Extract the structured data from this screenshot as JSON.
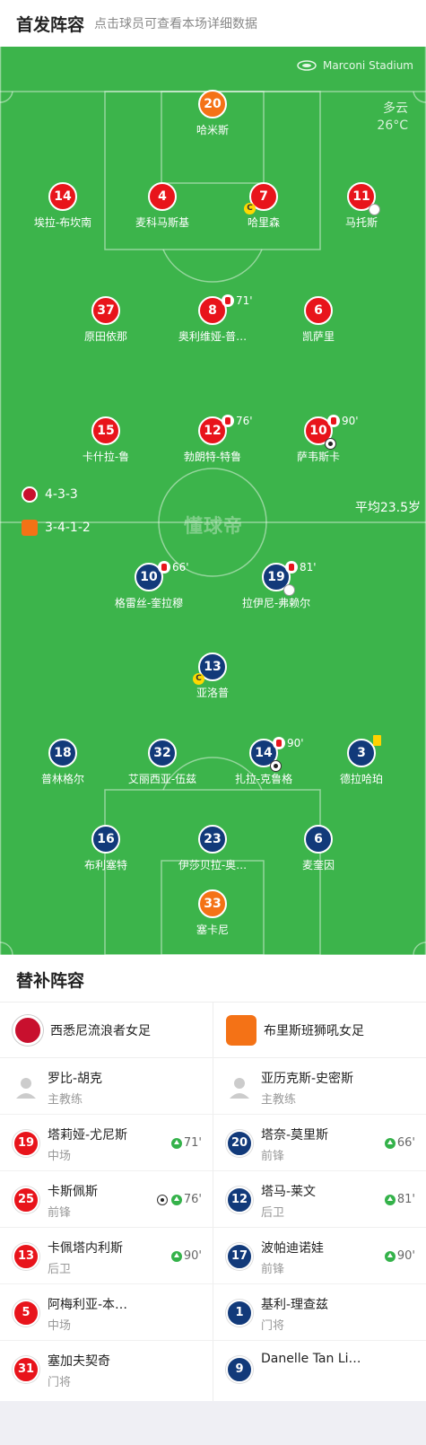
{
  "header": {
    "title": "首发阵容",
    "subtitle": "点击球员可查看本场详细数据"
  },
  "pitch": {
    "stadium": "Marconi Stadium",
    "weather": "多云",
    "temperature": "26°C",
    "watermark": "懂球帝",
    "home_formation": "4-3-3",
    "away_formation": "3-4-1-2",
    "avg_age": "平均23.5岁",
    "colors": {
      "pitch": "#3cb44b",
      "home": "#e8141b",
      "away": "#123a7a",
      "gk": "#f47216"
    },
    "home_players": [
      {
        "num": "20",
        "name": "哈米斯",
        "type": "gk"
      },
      {
        "num": "14",
        "name": "埃拉-布坎南"
      },
      {
        "num": "4",
        "name": "麦科马斯基"
      },
      {
        "num": "7",
        "name": "哈里森",
        "captain": "C"
      },
      {
        "num": "11",
        "name": "马托斯",
        "injury": true
      },
      {
        "num": "37",
        "name": "原田依那"
      },
      {
        "num": "8",
        "name": "奥利维娅-普…",
        "sub_time": "71'"
      },
      {
        "num": "6",
        "name": "凯萨里"
      },
      {
        "num": "15",
        "name": "卡什拉-鲁"
      },
      {
        "num": "12",
        "name": "勃朗特-特鲁",
        "sub_time": "76'"
      },
      {
        "num": "10",
        "name": "萨韦斯卡",
        "sub_time": "90'",
        "goal": true
      }
    ],
    "away_players": [
      {
        "num": "10",
        "name": "格雷丝-奎拉穆",
        "sub_time": "66'"
      },
      {
        "num": "19",
        "name": "拉伊尼-弗赖尔",
        "sub_time": "81'",
        "injury": true
      },
      {
        "num": "13",
        "name": "亚洛普",
        "captain": "C"
      },
      {
        "num": "18",
        "name": "普林格尔"
      },
      {
        "num": "32",
        "name": "艾丽西亚-伍兹"
      },
      {
        "num": "14",
        "name": "扎拉-克鲁格",
        "sub_time": "90'",
        "goal": true
      },
      {
        "num": "3",
        "name": "德拉哈珀",
        "yellow": true
      },
      {
        "num": "16",
        "name": "布利塞特"
      },
      {
        "num": "23",
        "name": "伊莎贝拉-奥…"
      },
      {
        "num": "6",
        "name": "麦奎因"
      },
      {
        "num": "33",
        "name": "塞卡尼",
        "type": "gk"
      }
    ]
  },
  "subs": {
    "title": "替补阵容",
    "home": {
      "team": "西悉尼流浪者女足",
      "coach": {
        "name": "罗比-胡克",
        "role": "主教练"
      },
      "players": [
        {
          "num": "19",
          "name": "塔莉娅-尤尼斯",
          "pos": "中场",
          "in": "71'"
        },
        {
          "num": "25",
          "name": "卡斯佩斯",
          "pos": "前锋",
          "in": "76'",
          "goal": true
        },
        {
          "num": "13",
          "name": "卡佩塔内利斯",
          "pos": "后卫",
          "in": "90'"
        },
        {
          "num": "5",
          "name": "阿梅利亚-本…",
          "pos": "中场"
        },
        {
          "num": "31",
          "name": "塞加夫契奇",
          "pos": "门将"
        }
      ]
    },
    "away": {
      "team": "布里斯班狮吼女足",
      "coach": {
        "name": "亚历克斯-史密斯",
        "role": "主教练"
      },
      "players": [
        {
          "num": "20",
          "name": "塔奈-莫里斯",
          "pos": "前锋",
          "in": "66'"
        },
        {
          "num": "12",
          "name": "塔马-莱文",
          "pos": "后卫",
          "in": "81'"
        },
        {
          "num": "17",
          "name": "波帕迪诺娃",
          "pos": "前锋",
          "in": "90'"
        },
        {
          "num": "1",
          "name": "基利-理查兹",
          "pos": "门将"
        },
        {
          "num": "9",
          "name": "Danelle Tan Li…",
          "pos": ""
        }
      ]
    }
  }
}
